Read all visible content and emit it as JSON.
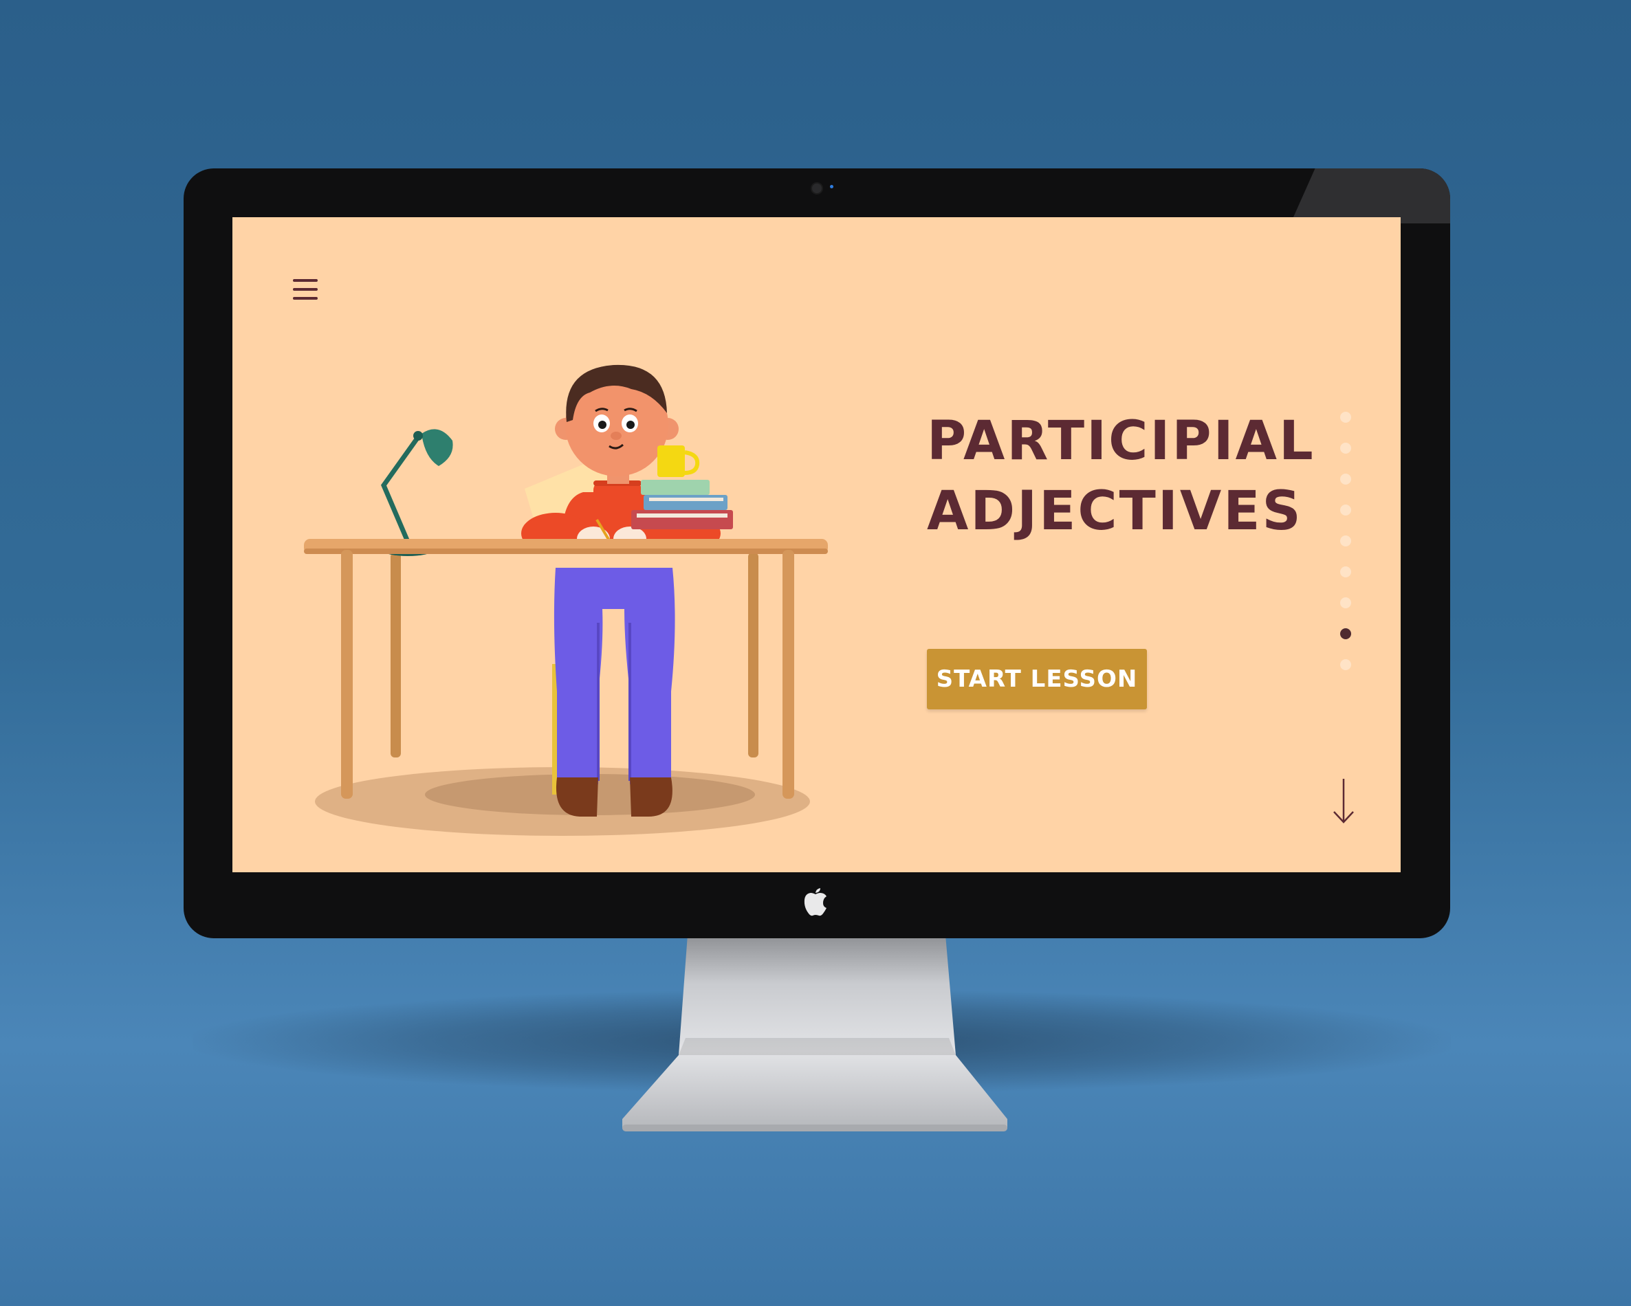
{
  "lesson": {
    "title_line1": "PARTICIPIAL",
    "title_line2": "ADJECTIVES",
    "cta_label": "START LESSON"
  },
  "navigation": {
    "menu_icon": "hamburger-menu-icon",
    "pagination": {
      "total": 9,
      "current": 8
    },
    "scroll_icon": "arrow-down-icon"
  },
  "illustration": {
    "subject": "student-at-desk-icon"
  },
  "colors": {
    "screen_background": "#ffd3a6",
    "title": "#5c2a33",
    "button": "#c99434",
    "button_text": "#ffffff",
    "dot_inactive": "#ffe3c6",
    "dot_active": "#4f2a30"
  }
}
